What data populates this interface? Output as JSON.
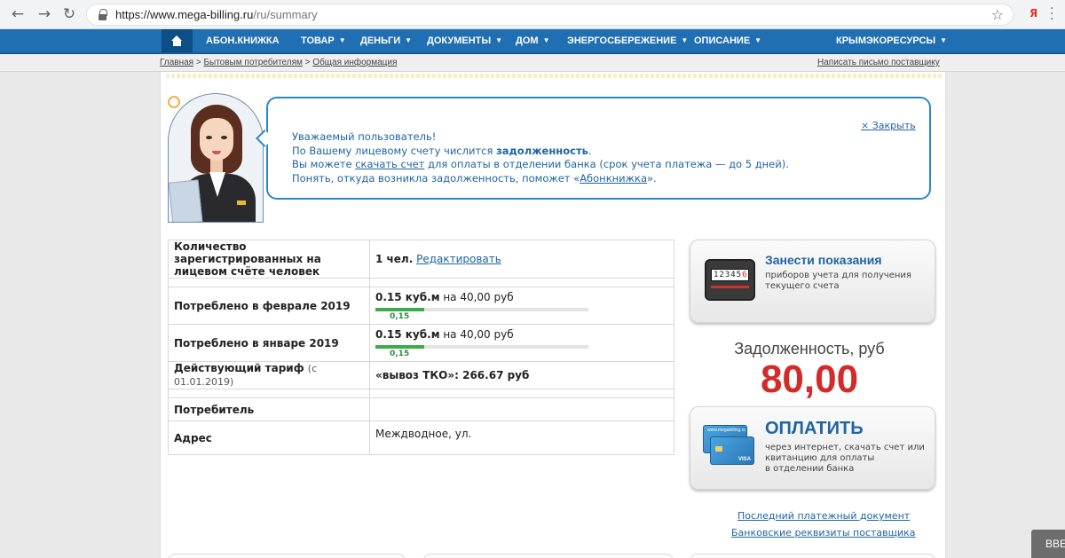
{
  "browser": {
    "url_base": "https://www.mega-billing.ru",
    "url_path": "/ru/summary",
    "extension_label": "Я"
  },
  "topnav": {
    "home_label": "home",
    "items": [
      {
        "label": "АБОН.КНИЖКА",
        "dropdown": false
      },
      {
        "label": "ТОВАР",
        "dropdown": true
      },
      {
        "label": "ДЕНЬГИ",
        "dropdown": true
      },
      {
        "label": "ДОКУМЕНТЫ",
        "dropdown": true
      },
      {
        "label": "ДОМ",
        "dropdown": true
      },
      {
        "label": "ЭНЕРГОСБЕРЕЖЕНИЕ",
        "dropdown": true
      },
      {
        "label": "ОПИСАНИЕ",
        "dropdown": true
      },
      {
        "label": "КРЫМЭКОРЕСУРСЫ",
        "dropdown": true
      }
    ],
    "bg_color": "#1f6fb2"
  },
  "breadcrumb": {
    "items": [
      "Главная",
      "Бытовым потребителям",
      "Общая информация"
    ],
    "separator": ">",
    "write_supplier": "Написать письмо поставщику"
  },
  "notice": {
    "line1": "Уважаемый пользователь!",
    "line2_prefix": "По Вашему лицевому счету числится ",
    "line2_bold": "задолженность",
    "line2_suffix": ".",
    "line3_prefix": "Вы можете ",
    "line3_link": "скачать счет",
    "line3_suffix": " для оплаты в отделении банка (срок учета платежа — до 5 дней).",
    "line4_prefix": "Понять, откуда возникла задолженность, поможет «",
    "line4_link": "Абонкнижка",
    "line4_suffix": "».",
    "close_label": "× Закрыть"
  },
  "account": {
    "registered_label": "Количество зарегистрированных на лицевом счёте человек",
    "registered_value": "1 чел.",
    "edit_link": "Редактировать",
    "consumption": [
      {
        "label": "Потреблено в феврале 2019",
        "amount": "0.15 куб.м",
        "cost": " на 40,00 руб",
        "bar_value": "0,15",
        "bar_fraction": 0.23
      },
      {
        "label": "Потреблено в январе 2019",
        "amount": "0.15 куб.м",
        "cost": " на 40,00 руб",
        "bar_value": "0,15",
        "bar_fraction": 0.23
      }
    ],
    "tariff_label": "Действующий тариф",
    "tariff_since": "(с 01.01.2019)",
    "tariff_value": "«вывоз ТКО»: 266.67 руб",
    "consumer_label": "Потребитель",
    "consumer_value": "",
    "address_label": "Адрес",
    "address_value": "Междводное, ул."
  },
  "readings_card": {
    "title": "Занести показания",
    "subtitle_line1": "приборов учета для получения",
    "subtitle_line2": "текущего счета",
    "meter_digits": "12345",
    "meter_red_digit": "6"
  },
  "debt": {
    "label": "Задолженность, руб",
    "amount": "80,00",
    "color": "#d42a2a"
  },
  "pay_card": {
    "title": "ОПЛАТИТЬ",
    "line1": "через интернет, скачать счет или",
    "line2": "квитанцию для оплаты",
    "line3": "в отделении банка",
    "card_brand": "www.megabilling.ru",
    "card_network": "VISA"
  },
  "links": {
    "last_payment": "Последний платежный документ",
    "bank_details": "Банковские реквизиты поставщика"
  },
  "toast": {
    "label": "ВВЕ"
  }
}
